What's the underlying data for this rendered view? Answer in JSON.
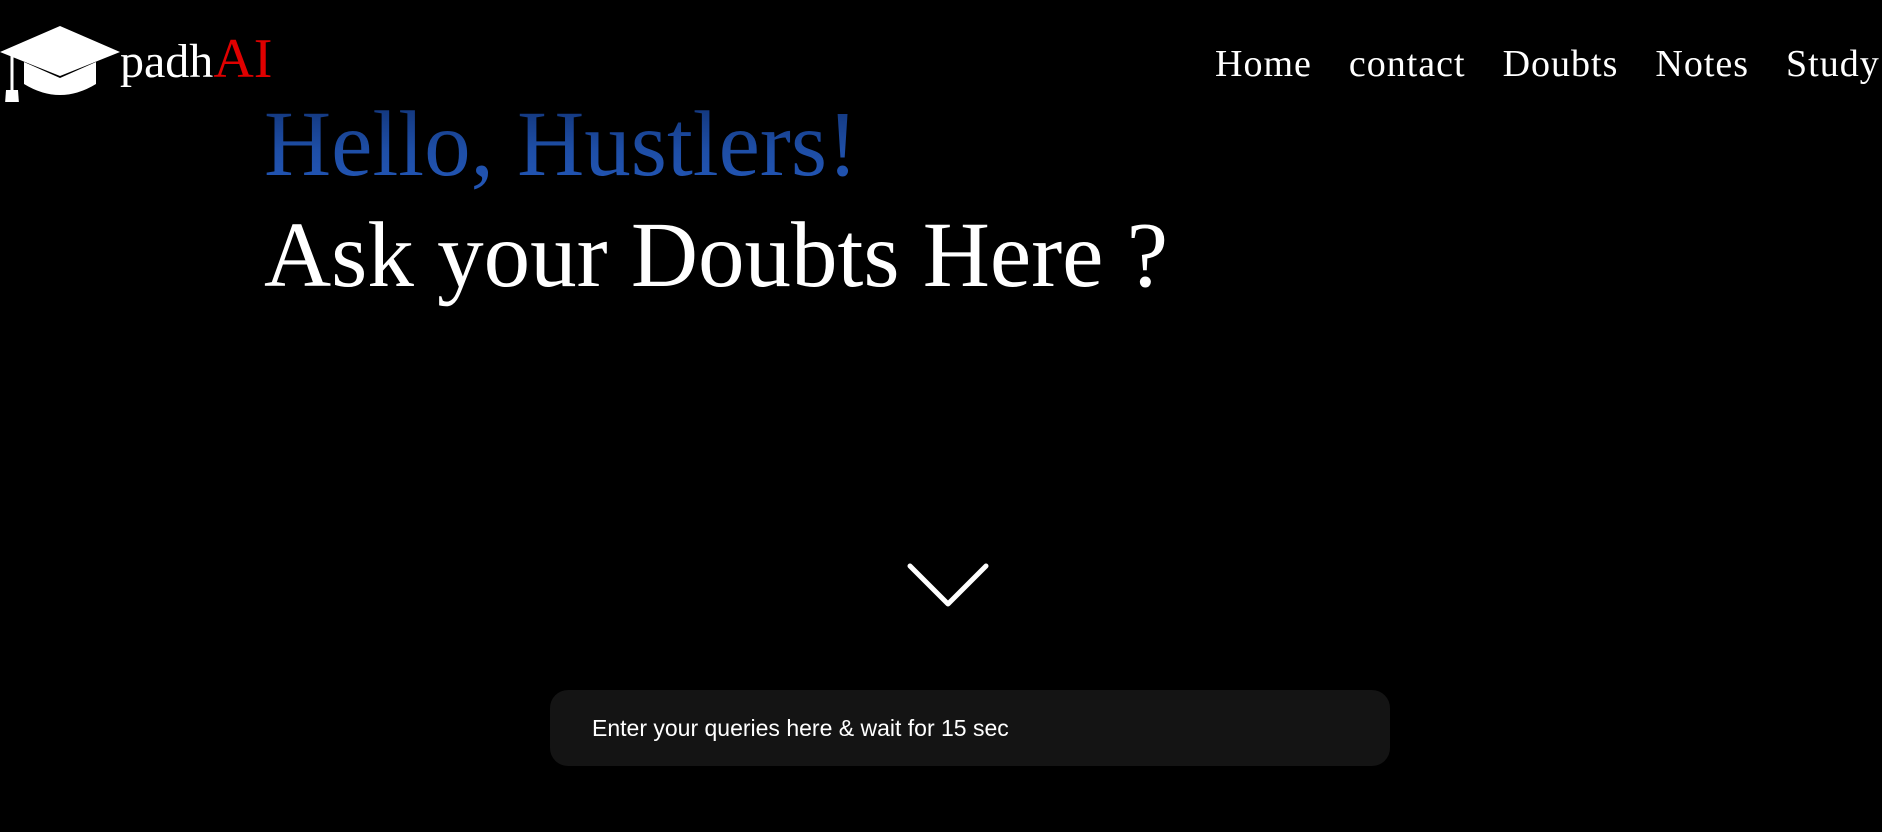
{
  "brand": {
    "name_main": "padh",
    "name_accent": "AI",
    "accent_color": "#e00000",
    "logo_icon": "graduation-cap-icon"
  },
  "nav": {
    "items": [
      {
        "label": "Home"
      },
      {
        "label": "contact"
      },
      {
        "label": "Doubts"
      },
      {
        "label": "Notes"
      },
      {
        "label": "Study"
      }
    ]
  },
  "hero": {
    "greeting": "Hello, Hustlers!",
    "greeting_color": "#1e4ea6",
    "title": "Ask your Doubts Here ?"
  },
  "scroll_indicator": {
    "icon": "chevron-down-icon"
  },
  "query": {
    "value": "",
    "placeholder": "Enter your queries here & wait for 15 sec"
  },
  "colors": {
    "background": "#000000",
    "text": "#ffffff",
    "input_background": "#141414"
  }
}
